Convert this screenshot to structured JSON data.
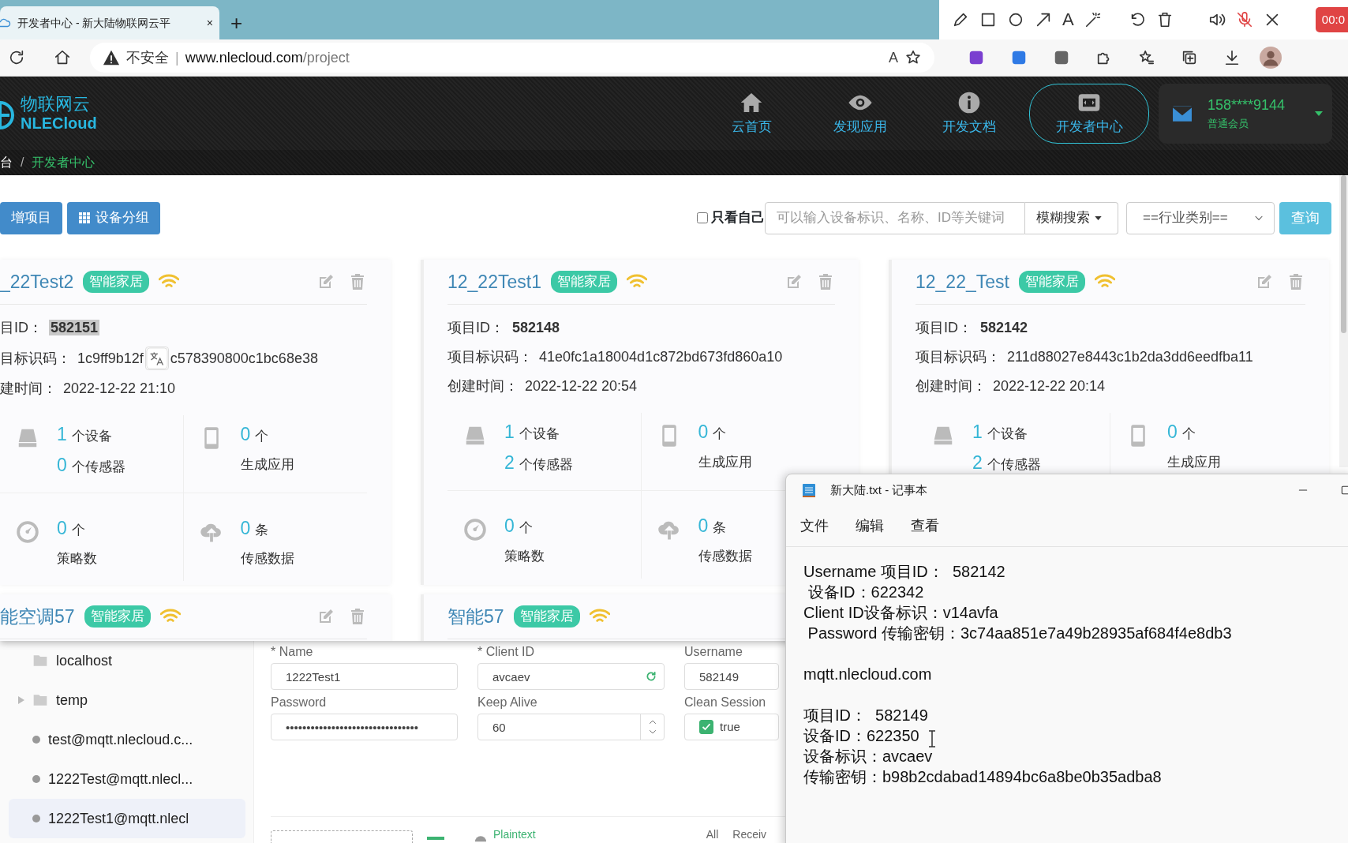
{
  "browser": {
    "tab": {
      "title": "开发者中心 - 新大陆物联网云平",
      "close": "×"
    },
    "new_tab": "+",
    "recorder": {
      "text_tool": "A",
      "timer": "00:0"
    },
    "address": {
      "security": "不安全",
      "host": "www.nlecloud.com",
      "path": "/project",
      "separator": "|",
      "read_aloud": "A"
    }
  },
  "site": {
    "logo": {
      "name": "物联网云",
      "brand": "NLECloud"
    },
    "nav": [
      {
        "label": "云首页",
        "selected": false
      },
      {
        "label": "发现应用",
        "selected": false
      },
      {
        "label": "开发文档",
        "selected": false
      },
      {
        "label": "开发者中心",
        "selected": true
      }
    ],
    "user": {
      "phone": "158****9144",
      "level": "普通会员"
    },
    "breadcrumb": [
      {
        "label": "台",
        "current": false
      },
      {
        "label": "开发者中心",
        "current": true
      }
    ],
    "breadcrumb_separator": "/"
  },
  "toolbar": {
    "buttons": [
      {
        "label": "增项目",
        "kind": "plain"
      },
      {
        "label": "设备分组",
        "kind": "grid"
      }
    ],
    "only_mine": {
      "label": "只看自己",
      "checked": false
    },
    "search": {
      "placeholder": "可以输入设备标识、名称、ID等关键词"
    },
    "search_mode": "模糊搜索",
    "industry": "==行业类别==",
    "submit": "查询"
  },
  "projects": [
    {
      "name": "_22Test2",
      "tag": "智能家居",
      "online": true,
      "actions": true,
      "id_label": "目ID：",
      "id": "582151",
      "id_selected": true,
      "code_label": "目标识码：",
      "code_parts": [
        "1c9ff9b12f",
        "c578390800c1bc68e38"
      ],
      "time_label": "建时间：",
      "time": "2022-12-22 21:10",
      "stats": [
        {
          "rows": [
            {
              "value": "1",
              "unit": "个设备"
            },
            {
              "value": "0",
              "unit": "个传感器"
            }
          ]
        },
        {
          "rows": [
            {
              "value": "0",
              "unit": "个"
            },
            {
              "caption": "生成应用"
            }
          ]
        },
        {
          "rows": [
            {
              "value": "0",
              "unit": "个"
            },
            {
              "caption": "策略数"
            }
          ]
        },
        {
          "rows": [
            {
              "value": "0",
              "unit": "条"
            },
            {
              "caption": "传感数据"
            }
          ]
        }
      ]
    },
    {
      "name": "12_22Test1",
      "tag": "智能家居",
      "online": true,
      "actions": true,
      "id_label": "项目ID：",
      "id": "582148",
      "id_selected": false,
      "code_label": "项目标识码：",
      "code_parts": [
        "41e0fc1a18004d1c872bd673fd860a10"
      ],
      "time_label": "创建时间：",
      "time": "2022-12-22 20:54",
      "stats": [
        {
          "rows": [
            {
              "value": "1",
              "unit": "个设备"
            },
            {
              "value": "2",
              "unit": "个传感器"
            }
          ]
        },
        {
          "rows": [
            {
              "value": "0",
              "unit": "个"
            },
            {
              "caption": "生成应用"
            }
          ]
        },
        {
          "rows": [
            {
              "value": "0",
              "unit": "个"
            },
            {
              "caption": "策略数"
            }
          ]
        },
        {
          "rows": [
            {
              "value": "0",
              "unit": "条"
            },
            {
              "caption": "传感数据"
            }
          ]
        }
      ]
    },
    {
      "name": "12_22_Test",
      "tag": "智能家居",
      "online": true,
      "actions": true,
      "id_label": "项目ID：",
      "id": "582142",
      "id_selected": false,
      "code_label": "项目标识码：",
      "code_parts": [
        "211d88027e8443c1b2da3dd6eedfba11"
      ],
      "time_label": "创建时间：",
      "time": "2022-12-22 20:14",
      "stats": [
        {
          "rows": [
            {
              "value": "1",
              "unit": "个设备"
            },
            {
              "value": "2",
              "unit": "个传感器"
            }
          ]
        },
        {
          "rows": [
            {
              "value": "0",
              "unit": "个"
            },
            {
              "caption": "生成应用"
            }
          ]
        }
      ]
    },
    {
      "name": "能空调57",
      "tag": "智能家居",
      "online": true,
      "actions": true
    },
    {
      "name": "智能57",
      "tag": "智能家居",
      "online": true,
      "actions": false
    }
  ],
  "mqttx": {
    "sidebar": [
      {
        "kind": "folder",
        "label": "localhost",
        "collapsed": false,
        "selected": false
      },
      {
        "kind": "folder",
        "label": "temp",
        "collapsed": true,
        "selected": false
      },
      {
        "kind": "connection",
        "label": "test@mqtt.nlecloud.c...",
        "selected": false
      },
      {
        "kind": "connection",
        "label": "1222Test@mqtt.nlecl...",
        "selected": false
      },
      {
        "kind": "connection",
        "label": "1222Test1@mqtt.nlecl",
        "selected": true
      }
    ],
    "fields": [
      {
        "kind": "text",
        "label": "* Name",
        "value": "1222Test1"
      },
      {
        "kind": "refresh",
        "label": "* Client ID",
        "value": "avcaev"
      },
      {
        "kind": "text",
        "label": "Username",
        "value": "582149"
      },
      {
        "kind": "text",
        "label": "Password",
        "value": "••••••••••••••••••••••••••••••••"
      },
      {
        "kind": "number",
        "label": "Keep Alive",
        "value": "60"
      },
      {
        "kind": "check",
        "label": "Clean Session",
        "value": "true",
        "checked": true
      }
    ],
    "bottom": {
      "format": "Plaintext",
      "filters": [
        "All",
        "Receiv"
      ]
    }
  },
  "notepad": {
    "title": "新大陆.txt - 记事本",
    "menu": [
      "文件",
      "编辑",
      "查看"
    ],
    "paragraphs": [
      [
        "Username 项目ID：  582142",
        " 设备ID：622342",
        "Client ID设备标识：v14avfa",
        " Password 传输密钥：3c74aa851e7a49b28935af684f4e8db3"
      ],
      [
        "mqtt.nlecloud.com"
      ],
      [
        "项目ID：  582149",
        "设备ID：622350",
        "设备标识：avcaev",
        "传输密钥：b98b2cdabad14894bc6a8be0b35adba8"
      ]
    ]
  }
}
